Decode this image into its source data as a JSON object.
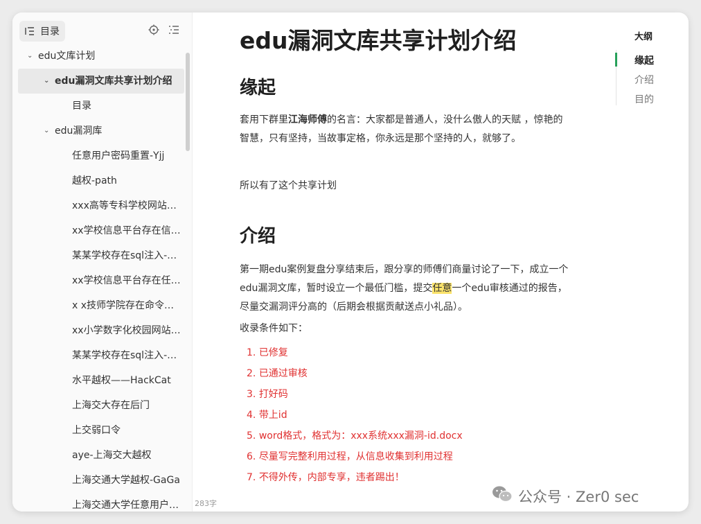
{
  "sidebar": {
    "toc_label": "目录",
    "tree": [
      {
        "label": "edu文库计划",
        "level": 0,
        "expanded": true,
        "active": false
      },
      {
        "label": "edu漏洞文库共享计划介绍",
        "level": 1,
        "expanded": true,
        "active": true
      },
      {
        "label": "目录",
        "level": 2,
        "expanded": null,
        "active": false
      },
      {
        "label": "edu漏洞库",
        "level": 1,
        "expanded": true,
        "active": false
      },
      {
        "label": "任意用户密码重置-Yjj",
        "level": 2,
        "expanded": null,
        "active": false
      },
      {
        "label": "越权-path",
        "level": 2,
        "expanded": null,
        "active": false
      },
      {
        "label": "xxx高等专科学校网站…",
        "level": 2,
        "expanded": null,
        "active": false
      },
      {
        "label": "xx学校信息平台存在信…",
        "level": 2,
        "expanded": null,
        "active": false
      },
      {
        "label": "某某学校存在sql注入-…",
        "level": 2,
        "expanded": null,
        "active": false
      },
      {
        "label": "xx学校信息平台存在任…",
        "level": 2,
        "expanded": null,
        "active": false
      },
      {
        "label": "x x技师学院存在命令…",
        "level": 2,
        "expanded": null,
        "active": false
      },
      {
        "label": "xx小学数字化校园网站…",
        "level": 2,
        "expanded": null,
        "active": false
      },
      {
        "label": "某某学校存在sql注入-…",
        "level": 2,
        "expanded": null,
        "active": false
      },
      {
        "label": "水平越权——HackCat",
        "level": 2,
        "expanded": null,
        "active": false
      },
      {
        "label": "上海交大存在后门",
        "level": 2,
        "expanded": null,
        "active": false
      },
      {
        "label": "上交弱口令",
        "level": 2,
        "expanded": null,
        "active": false
      },
      {
        "label": "aye-上海交大越权",
        "level": 2,
        "expanded": null,
        "active": false
      },
      {
        "label": "上海交通大学越权-GaGa",
        "level": 2,
        "expanded": null,
        "active": false
      },
      {
        "label": "上海交通大学任意用户…",
        "level": 2,
        "expanded": null,
        "active": false
      }
    ],
    "word_count": "283字"
  },
  "document": {
    "title": "edu漏洞文库共享计划介绍",
    "section1_heading": "缘起",
    "p1_pre": "套用下群里",
    "p1_bold": "江海师傅",
    "p1_post": "的名言：大家都是普通人，没什么傲人的天赋 ，惊艳的智慧，只有坚持，当故事定格，你永远是那个坚持的人，就够了。",
    "p2": "所以有了这个共享计划",
    "section2_heading": "介绍",
    "p3_pre": "第一期edu案例复盘分享结束后，跟分享的师傅们商量讨论了一下，成立一个edu漏洞文库，暂时设立一个最低门槛，提交",
    "p3_highlight": "任意",
    "p3_post": "一个edu审核通过的报告，尽量交漏洞评分高的（后期会根据贡献送点小礼品）。",
    "p4": "收录条件如下：",
    "conditions": [
      "已修复",
      "已通过审核",
      "打好码",
      "带上id",
      "word格式，格式为：xxx系统xxx漏洞-id.docx",
      "尽量写完整利用过程，从信息收集到利用过程",
      "不得外传，内部专享，违者踢出！"
    ]
  },
  "outline": {
    "title": "大纲",
    "items": [
      "缘起",
      "介绍",
      "目的"
    ],
    "active_index": 0
  },
  "watermark": {
    "text": "公众号 · Zer0 sec"
  },
  "colors": {
    "accent_green": "#27a05a",
    "list_red": "#e03131",
    "highlight_yellow": "#fbe36b"
  }
}
